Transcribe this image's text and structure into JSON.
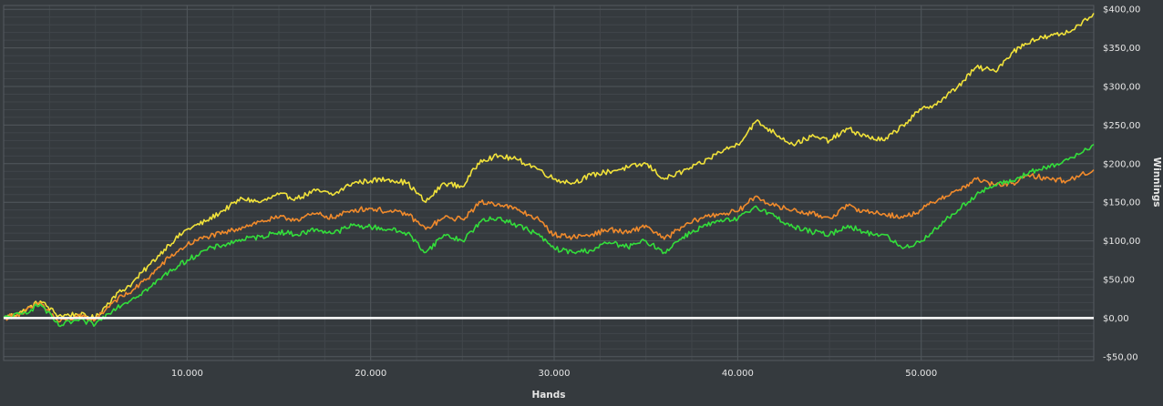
{
  "chart_data": {
    "type": "line",
    "title": "",
    "xlabel": "Hands",
    "ylabel": "Winnings",
    "xlim": [
      0,
      59400
    ],
    "ylim": [
      -55,
      405
    ],
    "x_ticks": [
      10000,
      20000,
      30000,
      40000,
      50000
    ],
    "x_tick_labels": [
      "10.000",
      "20.000",
      "30.000",
      "40.000",
      "50.000"
    ],
    "y_ticks": [
      -50,
      0,
      50,
      100,
      150,
      200,
      250,
      300,
      350,
      400
    ],
    "y_tick_labels": [
      "-$50,00",
      "$0,00",
      "$50,00",
      "$100,00",
      "$150,00",
      "$200,00",
      "$250,00",
      "$300,00",
      "$350,00",
      "$400,00"
    ],
    "grid": true,
    "y_axis_side": "right",
    "zero_line": {
      "value": 0,
      "color": "#ffffff"
    },
    "series": [
      {
        "color": "#f1e23a",
        "x": [
          0,
          1000,
          2000,
          3000,
          4000,
          5000,
          6000,
          7000,
          8000,
          9000,
          10000,
          11000,
          12000,
          13000,
          14000,
          15000,
          16000,
          17000,
          18000,
          19000,
          20000,
          21000,
          22000,
          23000,
          24000,
          25000,
          26000,
          27000,
          28000,
          29000,
          30000,
          31000,
          32000,
          33000,
          34000,
          35000,
          36000,
          37000,
          38000,
          39000,
          40000,
          41000,
          42000,
          43000,
          44000,
          45000,
          46000,
          47000,
          48000,
          49000,
          50000,
          51000,
          52000,
          53000,
          54000,
          55000,
          56000,
          57000,
          58000,
          59400
        ],
        "y": [
          0,
          8,
          22,
          3,
          5,
          0,
          28,
          45,
          70,
          95,
          115,
          125,
          140,
          155,
          150,
          160,
          155,
          165,
          160,
          175,
          178,
          180,
          175,
          150,
          175,
          170,
          205,
          210,
          205,
          195,
          180,
          175,
          185,
          190,
          195,
          200,
          180,
          190,
          200,
          215,
          225,
          255,
          240,
          225,
          235,
          230,
          245,
          235,
          230,
          250,
          270,
          280,
          300,
          325,
          320,
          345,
          360,
          365,
          370,
          395
        ]
      },
      {
        "color": "#f08a2c",
        "x": [
          0,
          1000,
          2000,
          3000,
          4000,
          5000,
          6000,
          7000,
          8000,
          9000,
          10000,
          11000,
          12000,
          13000,
          14000,
          15000,
          16000,
          17000,
          18000,
          19000,
          20000,
          21000,
          22000,
          23000,
          24000,
          25000,
          26000,
          27000,
          28000,
          29000,
          30000,
          31000,
          32000,
          33000,
          34000,
          35000,
          36000,
          37000,
          38000,
          39000,
          40000,
          41000,
          42000,
          43000,
          44000,
          45000,
          46000,
          47000,
          48000,
          49000,
          50000,
          51000,
          52000,
          53000,
          54000,
          55000,
          56000,
          57000,
          58000,
          59400
        ],
        "y": [
          0,
          6,
          20,
          -5,
          2,
          -2,
          22,
          35,
          55,
          78,
          95,
          105,
          110,
          118,
          125,
          130,
          128,
          135,
          130,
          140,
          142,
          138,
          135,
          115,
          130,
          128,
          150,
          148,
          140,
          130,
          108,
          105,
          108,
          115,
          110,
          120,
          102,
          118,
          130,
          135,
          138,
          158,
          145,
          140,
          135,
          130,
          145,
          138,
          135,
          130,
          140,
          155,
          165,
          180,
          172,
          175,
          185,
          180,
          178,
          192
        ]
      },
      {
        "color": "#33dd3b",
        "x": [
          0,
          1000,
          2000,
          3000,
          4000,
          5000,
          6000,
          7000,
          8000,
          9000,
          10000,
          11000,
          12000,
          13000,
          14000,
          15000,
          16000,
          17000,
          18000,
          19000,
          20000,
          21000,
          22000,
          23000,
          24000,
          25000,
          26000,
          27000,
          28000,
          29000,
          30000,
          31000,
          32000,
          33000,
          34000,
          35000,
          36000,
          37000,
          38000,
          39000,
          40000,
          41000,
          42000,
          43000,
          44000,
          45000,
          46000,
          47000,
          48000,
          49000,
          50000,
          51000,
          52000,
          53000,
          54000,
          55000,
          56000,
          57000,
          58000,
          59400
        ],
        "y": [
          0,
          5,
          18,
          -10,
          -3,
          -8,
          12,
          25,
          40,
          60,
          75,
          88,
          95,
          102,
          105,
          112,
          108,
          115,
          110,
          120,
          118,
          115,
          110,
          85,
          108,
          100,
          125,
          130,
          120,
          110,
          90,
          85,
          88,
          98,
          92,
          100,
          85,
          105,
          118,
          125,
          128,
          145,
          132,
          118,
          112,
          108,
          120,
          110,
          108,
          90,
          100,
          120,
          140,
          160,
          172,
          178,
          190,
          195,
          205,
          225
        ]
      }
    ]
  }
}
